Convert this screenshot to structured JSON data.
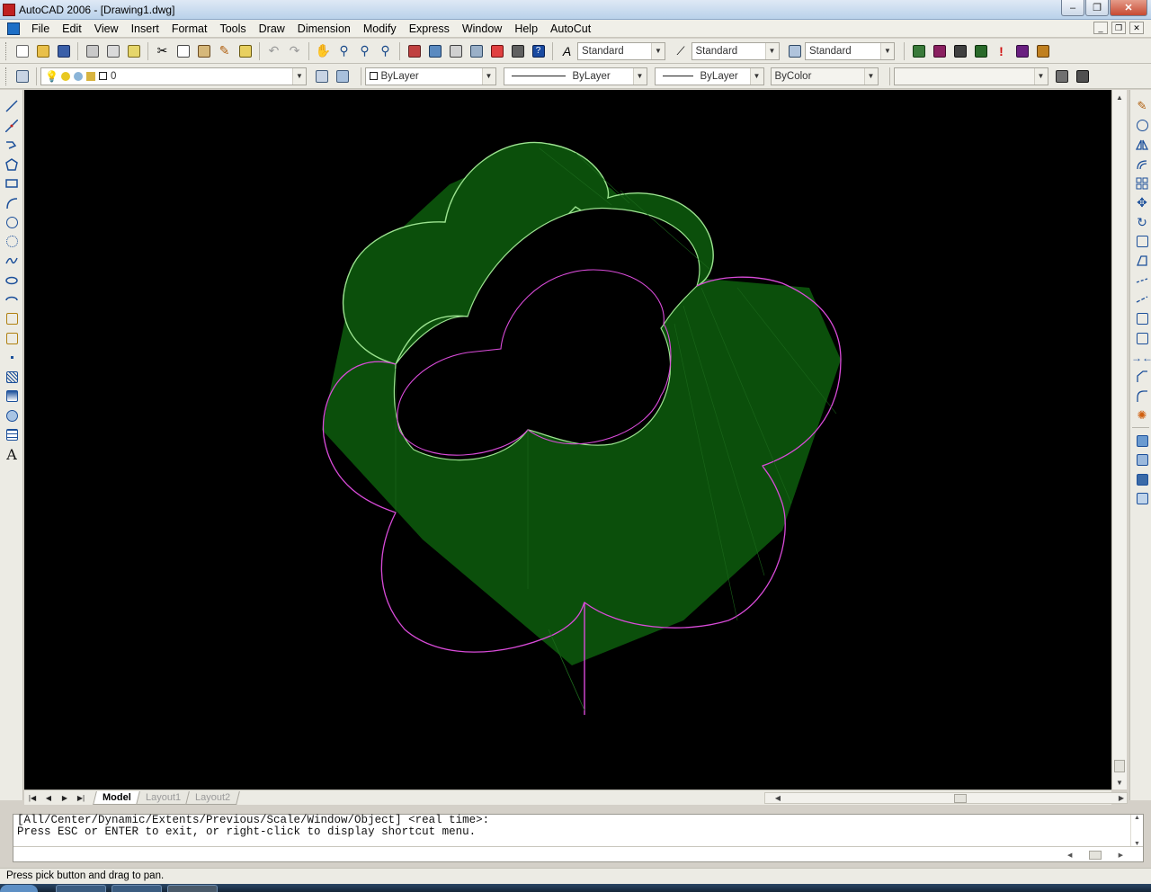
{
  "window": {
    "title": "AutoCAD 2006 - [Drawing1.dwg]",
    "minimize_glyph": "–",
    "maximize_glyph": "❐",
    "close_glyph": "✕"
  },
  "menu": {
    "items": [
      "File",
      "Edit",
      "View",
      "Insert",
      "Format",
      "Tools",
      "Draw",
      "Dimension",
      "Modify",
      "Express",
      "Window",
      "Help",
      "AutoCut"
    ]
  },
  "standard_toolbar": {
    "text_style": "Standard",
    "dim_style": "Standard",
    "table_style": "Standard"
  },
  "layers_toolbar": {
    "current_layer": "0"
  },
  "properties_toolbar": {
    "color": "ByLayer",
    "linetype": "ByLayer",
    "lineweight": "ByLayer",
    "plot_style": "ByColor"
  },
  "tabs": [
    {
      "label": "Model",
      "active": true
    },
    {
      "label": "Layout1",
      "active": false
    },
    {
      "label": "Layout2",
      "active": false
    }
  ],
  "command_line": {
    "line1": "[All/Center/Dynamic/Extents/Previous/Scale/Window/Object] <real time>:",
    "line2": "Press ESC or ENTER to exit, or right-click to display shortcut menu.",
    "input": ""
  },
  "status_bar": {
    "text": "Press pick button and drag to pan."
  },
  "colors": {
    "canvas_bg": "#000000",
    "solid_fill": "#0b4f0b",
    "edge_green": "#9be28f",
    "edge_magenta": "#d94bd9"
  },
  "icons": {
    "draw_toolbar": [
      "line-icon",
      "construction-line-icon",
      "polyline-icon",
      "polygon-icon",
      "rectangle-icon",
      "arc-icon",
      "circle-icon",
      "revision-cloud-icon",
      "spline-icon",
      "ellipse-icon",
      "ellipse-arc-icon",
      "insert-block-icon",
      "make-block-icon",
      "point-icon",
      "hatch-icon",
      "gradient-icon",
      "region-icon",
      "table-icon",
      "multiline-text-icon"
    ],
    "modify_toolbar": [
      "erase-icon",
      "copy-icon",
      "mirror-icon",
      "offset-icon",
      "array-icon",
      "move-icon",
      "rotate-icon",
      "scale-icon",
      "stretch-icon",
      "trim-icon",
      "extend-icon",
      "break-at-point-icon",
      "break-icon",
      "join-icon",
      "chamfer-icon",
      "fillet-icon",
      "explode-icon",
      "draworder-front-icon",
      "draworder-back-icon",
      "draworder-above-icon",
      "draworder-below-icon"
    ]
  }
}
